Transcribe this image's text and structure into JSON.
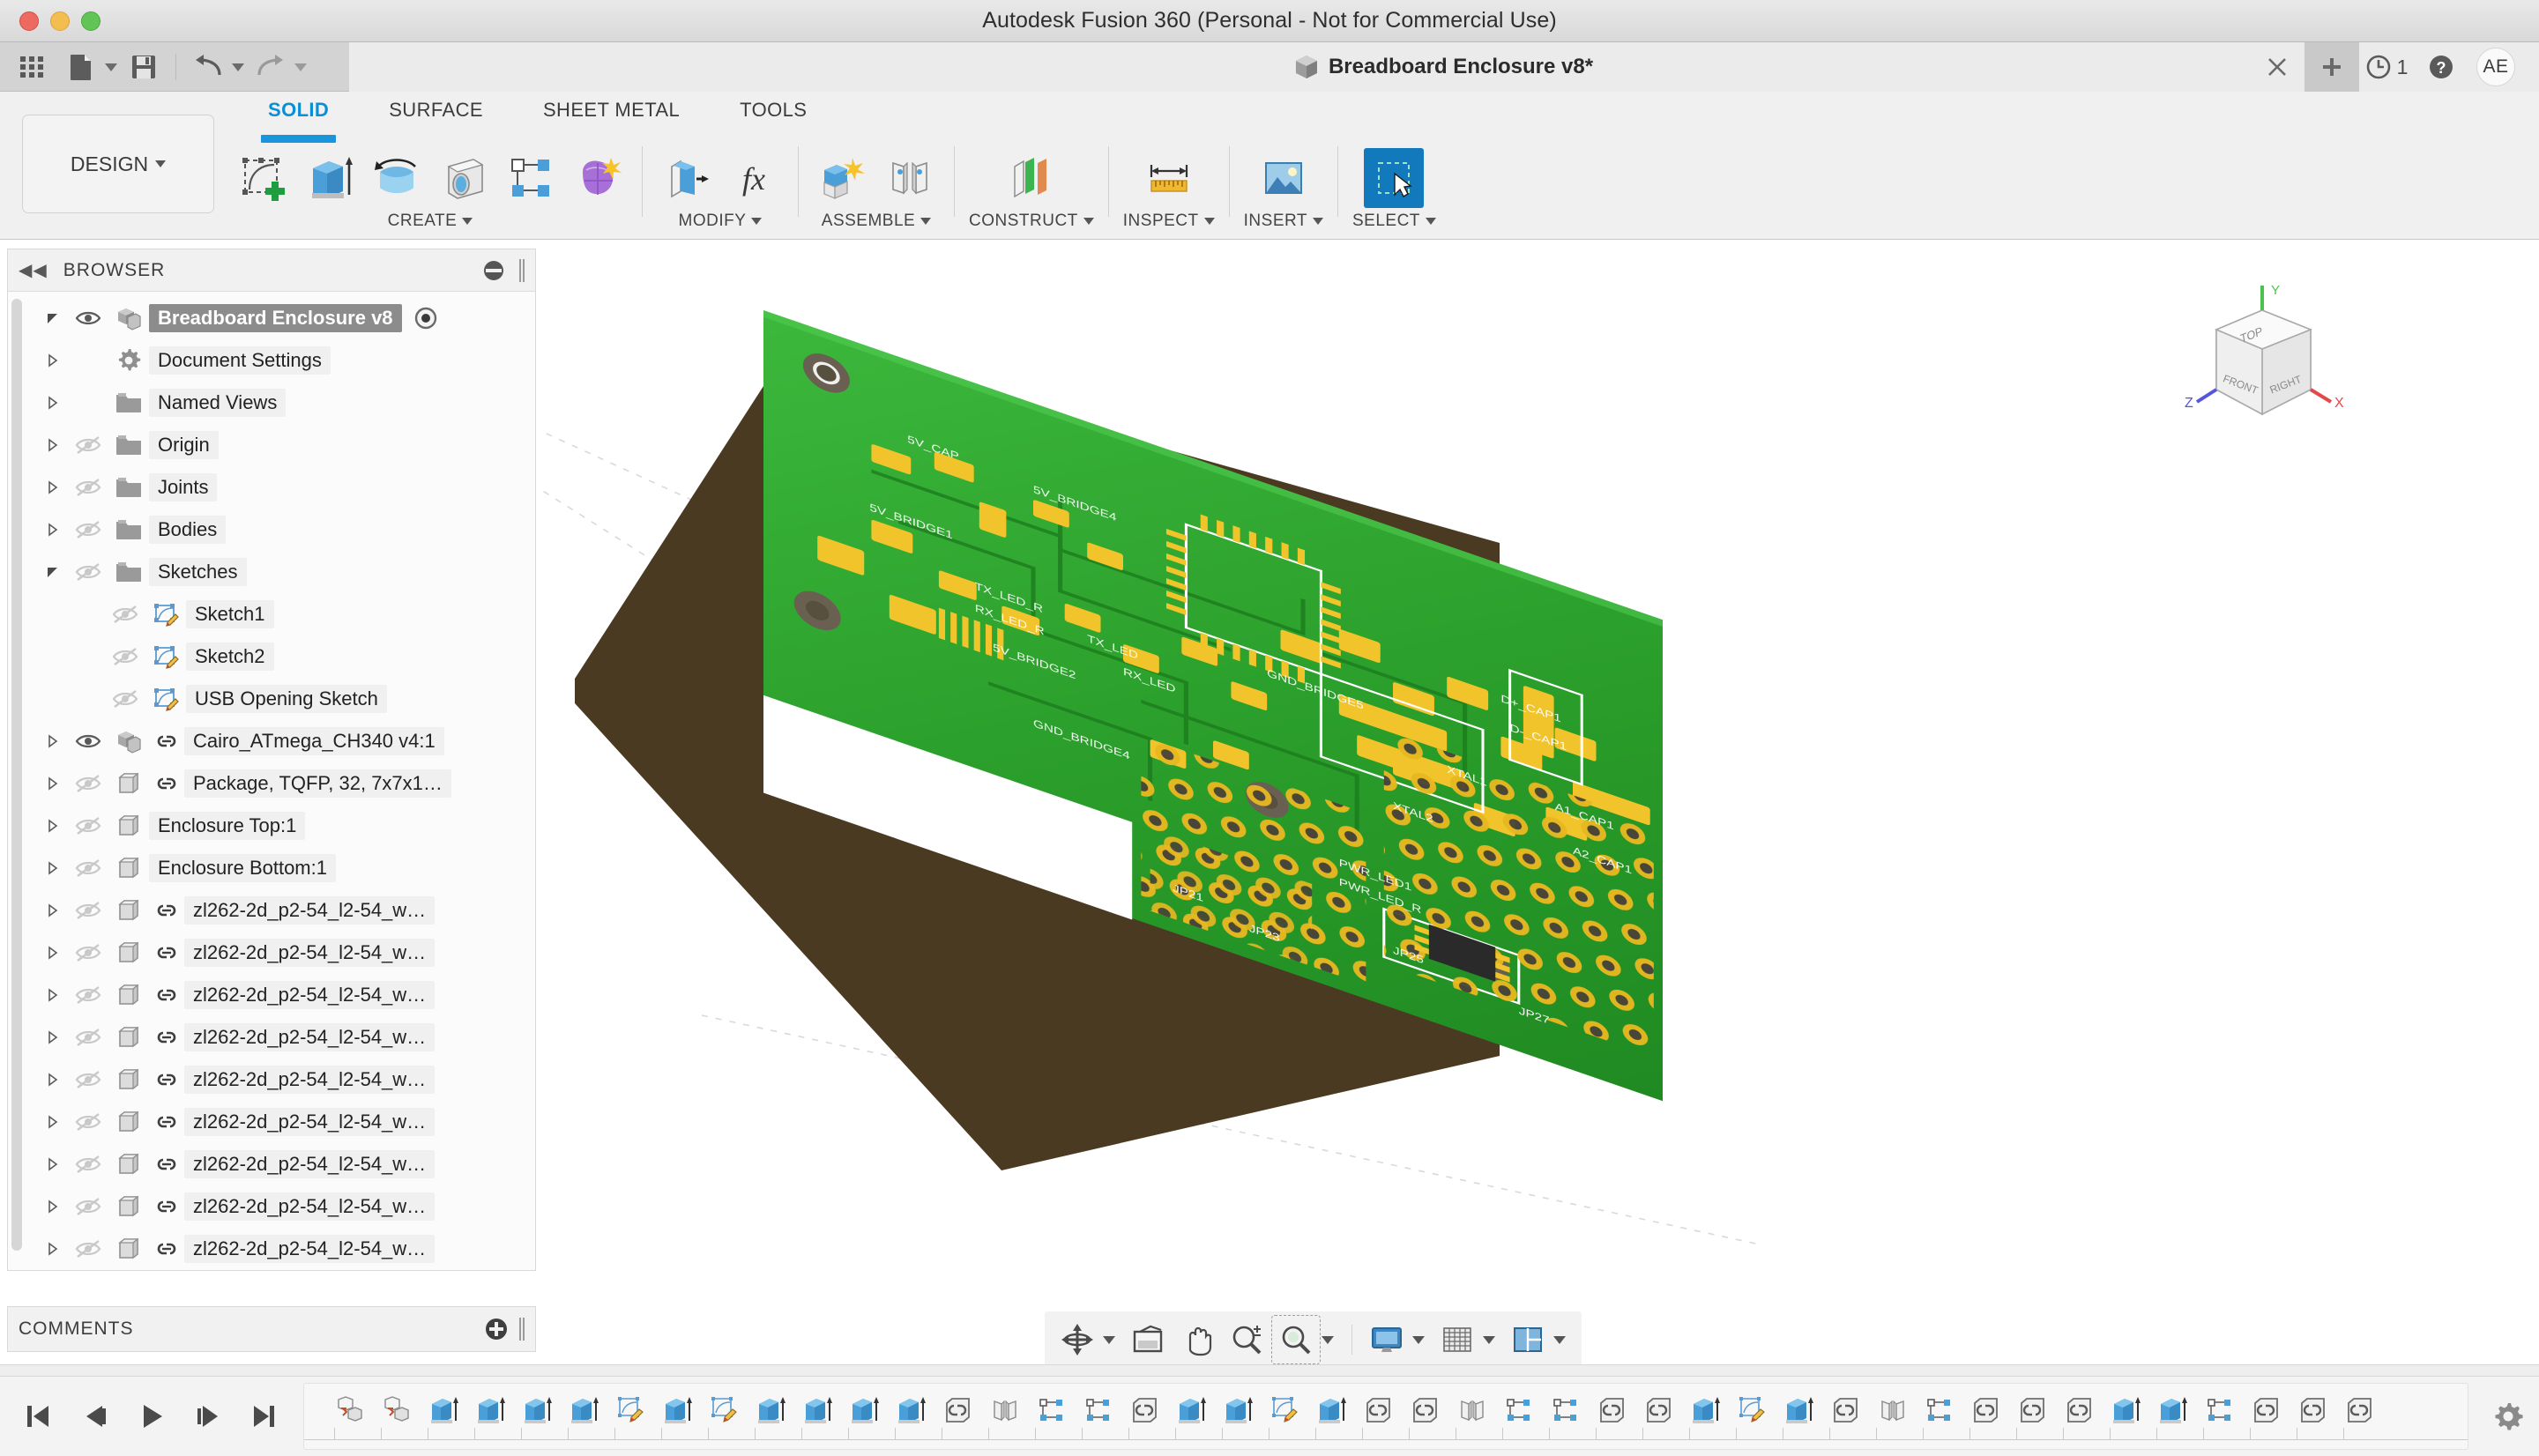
{
  "window": {
    "title": "Autodesk Fusion 360 (Personal - Not for Commercial Use)",
    "traffic": {
      "close": "close-button",
      "minimize": "minimize-button",
      "zoom": "zoom-button"
    }
  },
  "quickbar": {
    "items": [
      {
        "name": "app-grid",
        "icon": "grid-icon"
      },
      {
        "name": "new-file",
        "icon": "file-icon",
        "has_caret": true
      },
      {
        "name": "save",
        "icon": "save-icon"
      },
      {
        "name": "undo",
        "icon": "undo-icon",
        "has_caret": true
      },
      {
        "name": "redo",
        "icon": "redo-icon",
        "has_caret": true
      }
    ],
    "document_tab": "Breadboard Enclosure v8*",
    "close_label": "×",
    "new_tab_label": "+",
    "jobs_count": "1",
    "help_label": "?",
    "avatar_initials": "AE"
  },
  "ribbon": {
    "workspace": "DESIGN",
    "tabs": [
      {
        "label": "SOLID",
        "active": true
      },
      {
        "label": "SURFACE",
        "active": false
      },
      {
        "label": "SHEET METAL",
        "active": false
      },
      {
        "label": "TOOLS",
        "active": false
      }
    ],
    "groups": [
      {
        "label": "CREATE",
        "icons": [
          "create-sketch-icon",
          "extrude-icon",
          "revolve-icon",
          "sweep-icon",
          "pattern-icon",
          "form-icon"
        ]
      },
      {
        "label": "MODIFY",
        "icons": [
          "press-pull-icon",
          "change-parameters-icon"
        ]
      },
      {
        "label": "ASSEMBLE",
        "icons": [
          "new-component-icon",
          "joint-icon"
        ]
      },
      {
        "label": "CONSTRUCT",
        "icons": [
          "offset-plane-icon"
        ]
      },
      {
        "label": "INSPECT",
        "icons": [
          "measure-icon"
        ]
      },
      {
        "label": "INSERT",
        "icons": [
          "insert-image-icon"
        ]
      },
      {
        "label": "SELECT",
        "icons": [
          "select-window-icon"
        ],
        "selected": true
      }
    ]
  },
  "browser": {
    "title": "BROWSER",
    "collapse_icon": "collapse-left-icon",
    "options_icon": "panel-options-icon",
    "grip_icon": "resize-grip-icon",
    "rows": [
      {
        "label": "Breadboard Enclosure v8",
        "depth": 0,
        "expander": "expanded",
        "eye": "visible",
        "icon": "component-icon",
        "link": false,
        "selected": true,
        "radio": true
      },
      {
        "label": "Document Settings",
        "depth": 1,
        "expander": "collapsed",
        "eye": "none",
        "icon": "gear-icon",
        "link": false,
        "selected": false,
        "radio": false
      },
      {
        "label": "Named Views",
        "depth": 1,
        "expander": "collapsed",
        "eye": "none",
        "icon": "folder-icon",
        "link": false,
        "selected": false,
        "radio": false
      },
      {
        "label": "Origin",
        "depth": 1,
        "expander": "collapsed",
        "eye": "hidden",
        "icon": "folder-icon",
        "link": false,
        "selected": false,
        "radio": false
      },
      {
        "label": "Joints",
        "depth": 1,
        "expander": "collapsed",
        "eye": "hidden",
        "icon": "folder-icon",
        "link": false,
        "selected": false,
        "radio": false
      },
      {
        "label": "Bodies",
        "depth": 1,
        "expander": "collapsed",
        "eye": "hidden",
        "icon": "folder-icon",
        "link": false,
        "selected": false,
        "radio": false
      },
      {
        "label": "Sketches",
        "depth": 1,
        "expander": "expanded",
        "eye": "hidden",
        "icon": "folder-icon",
        "link": false,
        "selected": false,
        "radio": false
      },
      {
        "label": "Sketch1",
        "depth": 2,
        "expander": "none",
        "eye": "hidden",
        "icon": "sketch-icon",
        "link": false,
        "selected": false,
        "radio": false
      },
      {
        "label": "Sketch2",
        "depth": 2,
        "expander": "none",
        "eye": "hidden",
        "icon": "sketch-icon",
        "link": false,
        "selected": false,
        "radio": false
      },
      {
        "label": "USB Opening Sketch",
        "depth": 2,
        "expander": "none",
        "eye": "hidden",
        "icon": "sketch-icon",
        "link": false,
        "selected": false,
        "radio": false
      },
      {
        "label": "Cairo_ATmega_CH340 v4:1",
        "depth": 1,
        "expander": "collapsed",
        "eye": "visible",
        "icon": "component-icon",
        "link": true,
        "selected": false,
        "radio": false
      },
      {
        "label": "Package, TQFP, 32, 7x7x1…",
        "depth": 1,
        "expander": "collapsed",
        "eye": "hidden",
        "icon": "body-icon",
        "link": true,
        "selected": false,
        "radio": false
      },
      {
        "label": "Enclosure Top:1",
        "depth": 1,
        "expander": "collapsed",
        "eye": "hidden",
        "icon": "body-icon",
        "link": false,
        "selected": false,
        "radio": false
      },
      {
        "label": "Enclosure Bottom:1",
        "depth": 1,
        "expander": "collapsed",
        "eye": "hidden",
        "icon": "body-icon",
        "link": false,
        "selected": false,
        "radio": false
      },
      {
        "label": "zl262-2d_p2-54_l2-54_w…",
        "depth": 1,
        "expander": "collapsed",
        "eye": "hidden",
        "icon": "body-icon",
        "link": true,
        "selected": false,
        "radio": false
      },
      {
        "label": "zl262-2d_p2-54_l2-54_w…",
        "depth": 1,
        "expander": "collapsed",
        "eye": "hidden",
        "icon": "body-icon",
        "link": true,
        "selected": false,
        "radio": false
      },
      {
        "label": "zl262-2d_p2-54_l2-54_w…",
        "depth": 1,
        "expander": "collapsed",
        "eye": "hidden",
        "icon": "body-icon",
        "link": true,
        "selected": false,
        "radio": false
      },
      {
        "label": "zl262-2d_p2-54_l2-54_w…",
        "depth": 1,
        "expander": "collapsed",
        "eye": "hidden",
        "icon": "body-icon",
        "link": true,
        "selected": false,
        "radio": false
      },
      {
        "label": "zl262-2d_p2-54_l2-54_w…",
        "depth": 1,
        "expander": "collapsed",
        "eye": "hidden",
        "icon": "body-icon",
        "link": true,
        "selected": false,
        "radio": false
      },
      {
        "label": "zl262-2d_p2-54_l2-54_w…",
        "depth": 1,
        "expander": "collapsed",
        "eye": "hidden",
        "icon": "body-icon",
        "link": true,
        "selected": false,
        "radio": false
      },
      {
        "label": "zl262-2d_p2-54_l2-54_w…",
        "depth": 1,
        "expander": "collapsed",
        "eye": "hidden",
        "icon": "body-icon",
        "link": true,
        "selected": false,
        "radio": false
      },
      {
        "label": "zl262-2d_p2-54_l2-54_w…",
        "depth": 1,
        "expander": "collapsed",
        "eye": "hidden",
        "icon": "body-icon",
        "link": true,
        "selected": false,
        "radio": false
      },
      {
        "label": "zl262-2d_p2-54_l2-54_w…",
        "depth": 1,
        "expander": "collapsed",
        "eye": "hidden",
        "icon": "body-icon",
        "link": true,
        "selected": false,
        "radio": false
      }
    ]
  },
  "comments": {
    "title": "COMMENTS",
    "add_icon": "add-comment-icon",
    "grip_icon": "resize-grip-icon"
  },
  "viewcube": {
    "top_face": "TOP",
    "front_face": "FRONT",
    "right_face": "RIGHT",
    "axis_x": "X",
    "axis_y": "Y",
    "axis_z": "Z",
    "color_x": "#e24a4a",
    "color_y": "#4cc14c",
    "color_z": "#5555dd"
  },
  "navbar": {
    "items": [
      {
        "name": "orbit-icon",
        "caret": true
      },
      {
        "name": "look-at-icon",
        "caret": false
      },
      {
        "name": "pan-icon",
        "caret": false
      },
      {
        "name": "zoom-icon",
        "caret": false
      },
      {
        "name": "zoom-window-icon",
        "caret": true
      },
      {
        "name": "display-settings-icon",
        "caret": true
      },
      {
        "name": "grid-snap-icon",
        "caret": true
      },
      {
        "name": "viewports-icon",
        "caret": true
      }
    ]
  },
  "timeline": {
    "playback": [
      "go-to-start-icon",
      "step-back-icon",
      "play-icon",
      "step-forward-icon",
      "go-to-end-icon"
    ],
    "features": [
      "new-component-icon",
      "new-component-icon",
      "extrude-icon",
      "extrude-icon",
      "extrude-icon",
      "extrude-icon",
      "sketch-icon",
      "extrude-icon",
      "sketch-icon",
      "extrude-icon",
      "extrude-icon",
      "extrude-icon",
      "extrude-icon",
      "link-icon",
      "joint-icon",
      "pattern-icon",
      "pattern-icon",
      "link-icon",
      "extrude-icon",
      "extrude-icon",
      "sketch-icon",
      "extrude-icon",
      "link-icon",
      "link-icon",
      "joint-icon",
      "pattern-icon",
      "pattern-icon",
      "link-icon",
      "link-icon",
      "extrude-icon",
      "sketch-icon",
      "extrude-icon",
      "link-icon",
      "joint-icon",
      "pattern-icon",
      "link-icon",
      "link-icon",
      "link-icon",
      "extrude-icon",
      "extrude-icon",
      "pattern-icon",
      "link-icon",
      "link-icon",
      "link-icon"
    ],
    "settings_icon": "timeline-settings-icon",
    "marker": "timeline-marker"
  },
  "model": {
    "description": "PCB board 3D view",
    "colors": {
      "soldermask": "#2a9d2a",
      "soldermask_light": "#3cb83c",
      "pad_gold": "#f0c42a",
      "silkscreen": "#ffffff",
      "board_edge": "#4a3a22",
      "hole": "#4d4438"
    },
    "silkscreen_labels": [
      "5V_CAP",
      "5V_BRIDGE1",
      "5V_BRIDGE4",
      "GND_BRIDGE5",
      "GND_BRIDGE4",
      "TX_LED_R",
      "RX_LED_R",
      "5V_BRIDGE2",
      "TX_LED",
      "RX_LED",
      "D+_CAP1",
      "D-_CAP1",
      "XTAL1",
      "XTAL2",
      "A1_CAP1",
      "A2_CAP1",
      "PWR_LED1",
      "PWR_LED_R",
      "JP21",
      "JP23",
      "JP25",
      "JP27"
    ]
  }
}
